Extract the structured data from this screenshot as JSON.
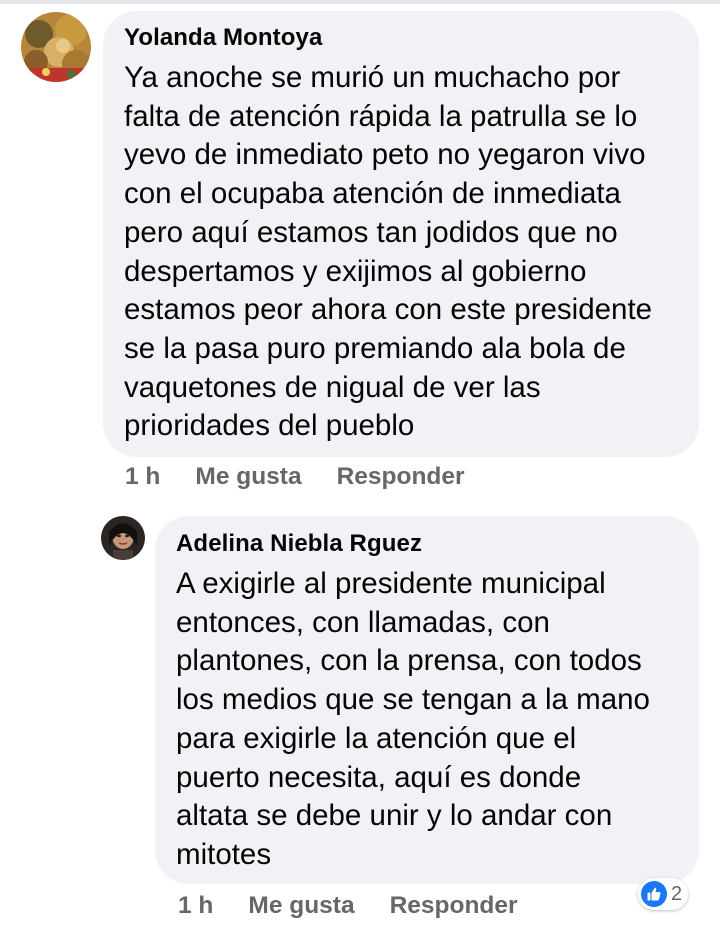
{
  "comments": [
    {
      "author": "Yolanda Montoya",
      "text": "Ya anoche se murió un muchacho por\nfalta de atención rápida la patrulla se lo\nyevo de inmediato peto no yegaron vivo\ncon el ocupaba atención de inmediata\npero aquí estamos tan jodidos que no\ndespertamos y exijimos al gobierno\nestamos peor ahora con este presidente\nse la pasa puro premiando ala bola de\nvaquetones de nigual de ver las\nprioridades del pueblo",
      "time": "1 h",
      "like_label": "Me gusta",
      "reply_label": "Responder"
    },
    {
      "author": "Adelina Niebla Rguez",
      "text": "A exigirle al presidente municipal\nentonces, con llamadas, con\nplantones, con la prensa, con todos\nlos medios que se tengan a la mano\npara exigirle la atención que el\npuerto necesita, aquí es donde\naltata se debe unir y lo andar con\nmitotes",
      "time": "1 h",
      "like_label": "Me gusta",
      "reply_label": "Responder",
      "reaction_icon": "like-icon",
      "reaction_count": "2"
    }
  ],
  "colors": {
    "bubble": "#f0f2f5",
    "meta_text": "#65676b",
    "like_blue": "#1877f2"
  }
}
